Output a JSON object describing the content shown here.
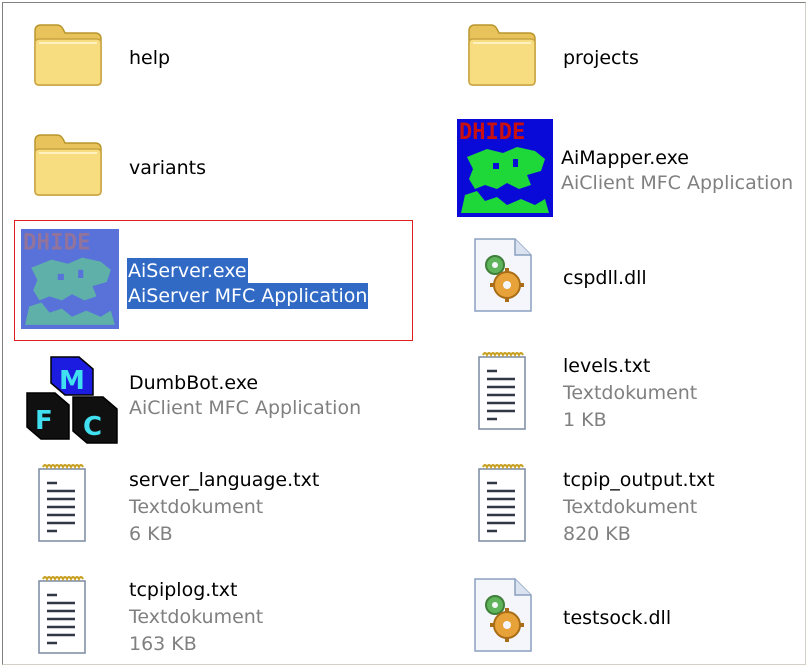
{
  "items": [
    {
      "name": "help",
      "lines": [
        "help"
      ]
    },
    {
      "name": "projects",
      "lines": [
        "projects"
      ]
    },
    {
      "name": "variants",
      "lines": [
        "variants"
      ]
    },
    {
      "name": "aimapper",
      "lines": [
        "AiMapper.exe",
        "AiClient MFC Application"
      ]
    },
    {
      "name": "aiserver",
      "lines": [
        "AiServer.exe",
        "AiServer MFC Application"
      ]
    },
    {
      "name": "cspdll",
      "lines": [
        "cspdll.dll"
      ]
    },
    {
      "name": "dumbbot",
      "lines": [
        "DumbBot.exe",
        "AiClient MFC Application"
      ]
    },
    {
      "name": "levels",
      "lines": [
        "levels.txt",
        "Textdokument",
        "1 KB"
      ]
    },
    {
      "name": "server-language",
      "lines": [
        "server_language.txt",
        "Textdokument",
        "6 KB"
      ]
    },
    {
      "name": "tcpip-output",
      "lines": [
        "tcpip_output.txt",
        "Textdokument",
        "820 KB"
      ]
    },
    {
      "name": "tcpiplog",
      "lines": [
        "tcpiplog.txt",
        "Textdokument",
        "163 KB"
      ]
    },
    {
      "name": "testsock",
      "lines": [
        "testsock.dll"
      ]
    }
  ],
  "icons": {
    "folder": "folder-icon",
    "dhide": "dhide-app-icon",
    "mfc": "mfc-app-icon",
    "text": "text-document-icon",
    "dll": "dll-gear-icon"
  },
  "dhide_label": "DHIDE",
  "mfc_letters": [
    "M",
    "F",
    "C"
  ],
  "colors": {
    "selection": "#316ac5",
    "highlight_border": "#e02020",
    "folder": "#f5d679",
    "secondary_text": "#808080"
  }
}
